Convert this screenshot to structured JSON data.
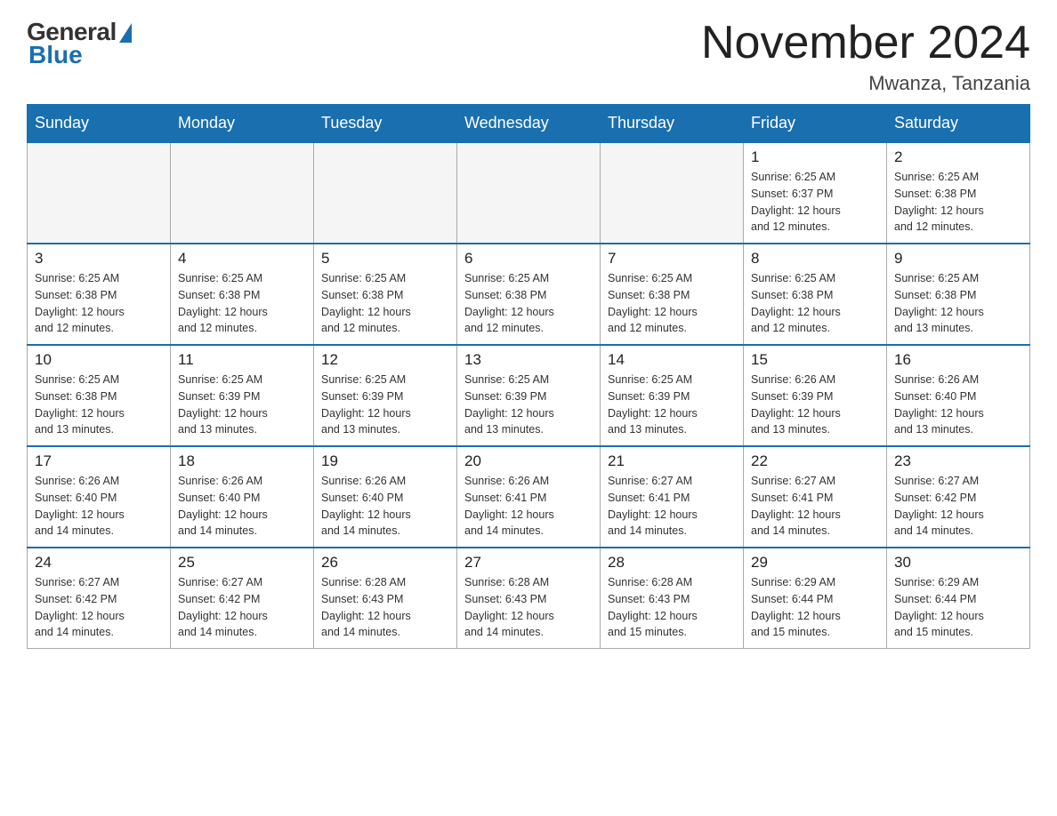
{
  "header": {
    "logo": {
      "general": "General",
      "blue": "Blue"
    },
    "title": "November 2024",
    "location": "Mwanza, Tanzania"
  },
  "days_of_week": [
    "Sunday",
    "Monday",
    "Tuesday",
    "Wednesday",
    "Thursday",
    "Friday",
    "Saturday"
  ],
  "weeks": [
    [
      {
        "day": "",
        "info": ""
      },
      {
        "day": "",
        "info": ""
      },
      {
        "day": "",
        "info": ""
      },
      {
        "day": "",
        "info": ""
      },
      {
        "day": "",
        "info": ""
      },
      {
        "day": "1",
        "info": "Sunrise: 6:25 AM\nSunset: 6:37 PM\nDaylight: 12 hours\nand 12 minutes."
      },
      {
        "day": "2",
        "info": "Sunrise: 6:25 AM\nSunset: 6:38 PM\nDaylight: 12 hours\nand 12 minutes."
      }
    ],
    [
      {
        "day": "3",
        "info": "Sunrise: 6:25 AM\nSunset: 6:38 PM\nDaylight: 12 hours\nand 12 minutes."
      },
      {
        "day": "4",
        "info": "Sunrise: 6:25 AM\nSunset: 6:38 PM\nDaylight: 12 hours\nand 12 minutes."
      },
      {
        "day": "5",
        "info": "Sunrise: 6:25 AM\nSunset: 6:38 PM\nDaylight: 12 hours\nand 12 minutes."
      },
      {
        "day": "6",
        "info": "Sunrise: 6:25 AM\nSunset: 6:38 PM\nDaylight: 12 hours\nand 12 minutes."
      },
      {
        "day": "7",
        "info": "Sunrise: 6:25 AM\nSunset: 6:38 PM\nDaylight: 12 hours\nand 12 minutes."
      },
      {
        "day": "8",
        "info": "Sunrise: 6:25 AM\nSunset: 6:38 PM\nDaylight: 12 hours\nand 12 minutes."
      },
      {
        "day": "9",
        "info": "Sunrise: 6:25 AM\nSunset: 6:38 PM\nDaylight: 12 hours\nand 13 minutes."
      }
    ],
    [
      {
        "day": "10",
        "info": "Sunrise: 6:25 AM\nSunset: 6:38 PM\nDaylight: 12 hours\nand 13 minutes."
      },
      {
        "day": "11",
        "info": "Sunrise: 6:25 AM\nSunset: 6:39 PM\nDaylight: 12 hours\nand 13 minutes."
      },
      {
        "day": "12",
        "info": "Sunrise: 6:25 AM\nSunset: 6:39 PM\nDaylight: 12 hours\nand 13 minutes."
      },
      {
        "day": "13",
        "info": "Sunrise: 6:25 AM\nSunset: 6:39 PM\nDaylight: 12 hours\nand 13 minutes."
      },
      {
        "day": "14",
        "info": "Sunrise: 6:25 AM\nSunset: 6:39 PM\nDaylight: 12 hours\nand 13 minutes."
      },
      {
        "day": "15",
        "info": "Sunrise: 6:26 AM\nSunset: 6:39 PM\nDaylight: 12 hours\nand 13 minutes."
      },
      {
        "day": "16",
        "info": "Sunrise: 6:26 AM\nSunset: 6:40 PM\nDaylight: 12 hours\nand 13 minutes."
      }
    ],
    [
      {
        "day": "17",
        "info": "Sunrise: 6:26 AM\nSunset: 6:40 PM\nDaylight: 12 hours\nand 14 minutes."
      },
      {
        "day": "18",
        "info": "Sunrise: 6:26 AM\nSunset: 6:40 PM\nDaylight: 12 hours\nand 14 minutes."
      },
      {
        "day": "19",
        "info": "Sunrise: 6:26 AM\nSunset: 6:40 PM\nDaylight: 12 hours\nand 14 minutes."
      },
      {
        "day": "20",
        "info": "Sunrise: 6:26 AM\nSunset: 6:41 PM\nDaylight: 12 hours\nand 14 minutes."
      },
      {
        "day": "21",
        "info": "Sunrise: 6:27 AM\nSunset: 6:41 PM\nDaylight: 12 hours\nand 14 minutes."
      },
      {
        "day": "22",
        "info": "Sunrise: 6:27 AM\nSunset: 6:41 PM\nDaylight: 12 hours\nand 14 minutes."
      },
      {
        "day": "23",
        "info": "Sunrise: 6:27 AM\nSunset: 6:42 PM\nDaylight: 12 hours\nand 14 minutes."
      }
    ],
    [
      {
        "day": "24",
        "info": "Sunrise: 6:27 AM\nSunset: 6:42 PM\nDaylight: 12 hours\nand 14 minutes."
      },
      {
        "day": "25",
        "info": "Sunrise: 6:27 AM\nSunset: 6:42 PM\nDaylight: 12 hours\nand 14 minutes."
      },
      {
        "day": "26",
        "info": "Sunrise: 6:28 AM\nSunset: 6:43 PM\nDaylight: 12 hours\nand 14 minutes."
      },
      {
        "day": "27",
        "info": "Sunrise: 6:28 AM\nSunset: 6:43 PM\nDaylight: 12 hours\nand 14 minutes."
      },
      {
        "day": "28",
        "info": "Sunrise: 6:28 AM\nSunset: 6:43 PM\nDaylight: 12 hours\nand 15 minutes."
      },
      {
        "day": "29",
        "info": "Sunrise: 6:29 AM\nSunset: 6:44 PM\nDaylight: 12 hours\nand 15 minutes."
      },
      {
        "day": "30",
        "info": "Sunrise: 6:29 AM\nSunset: 6:44 PM\nDaylight: 12 hours\nand 15 minutes."
      }
    ]
  ]
}
